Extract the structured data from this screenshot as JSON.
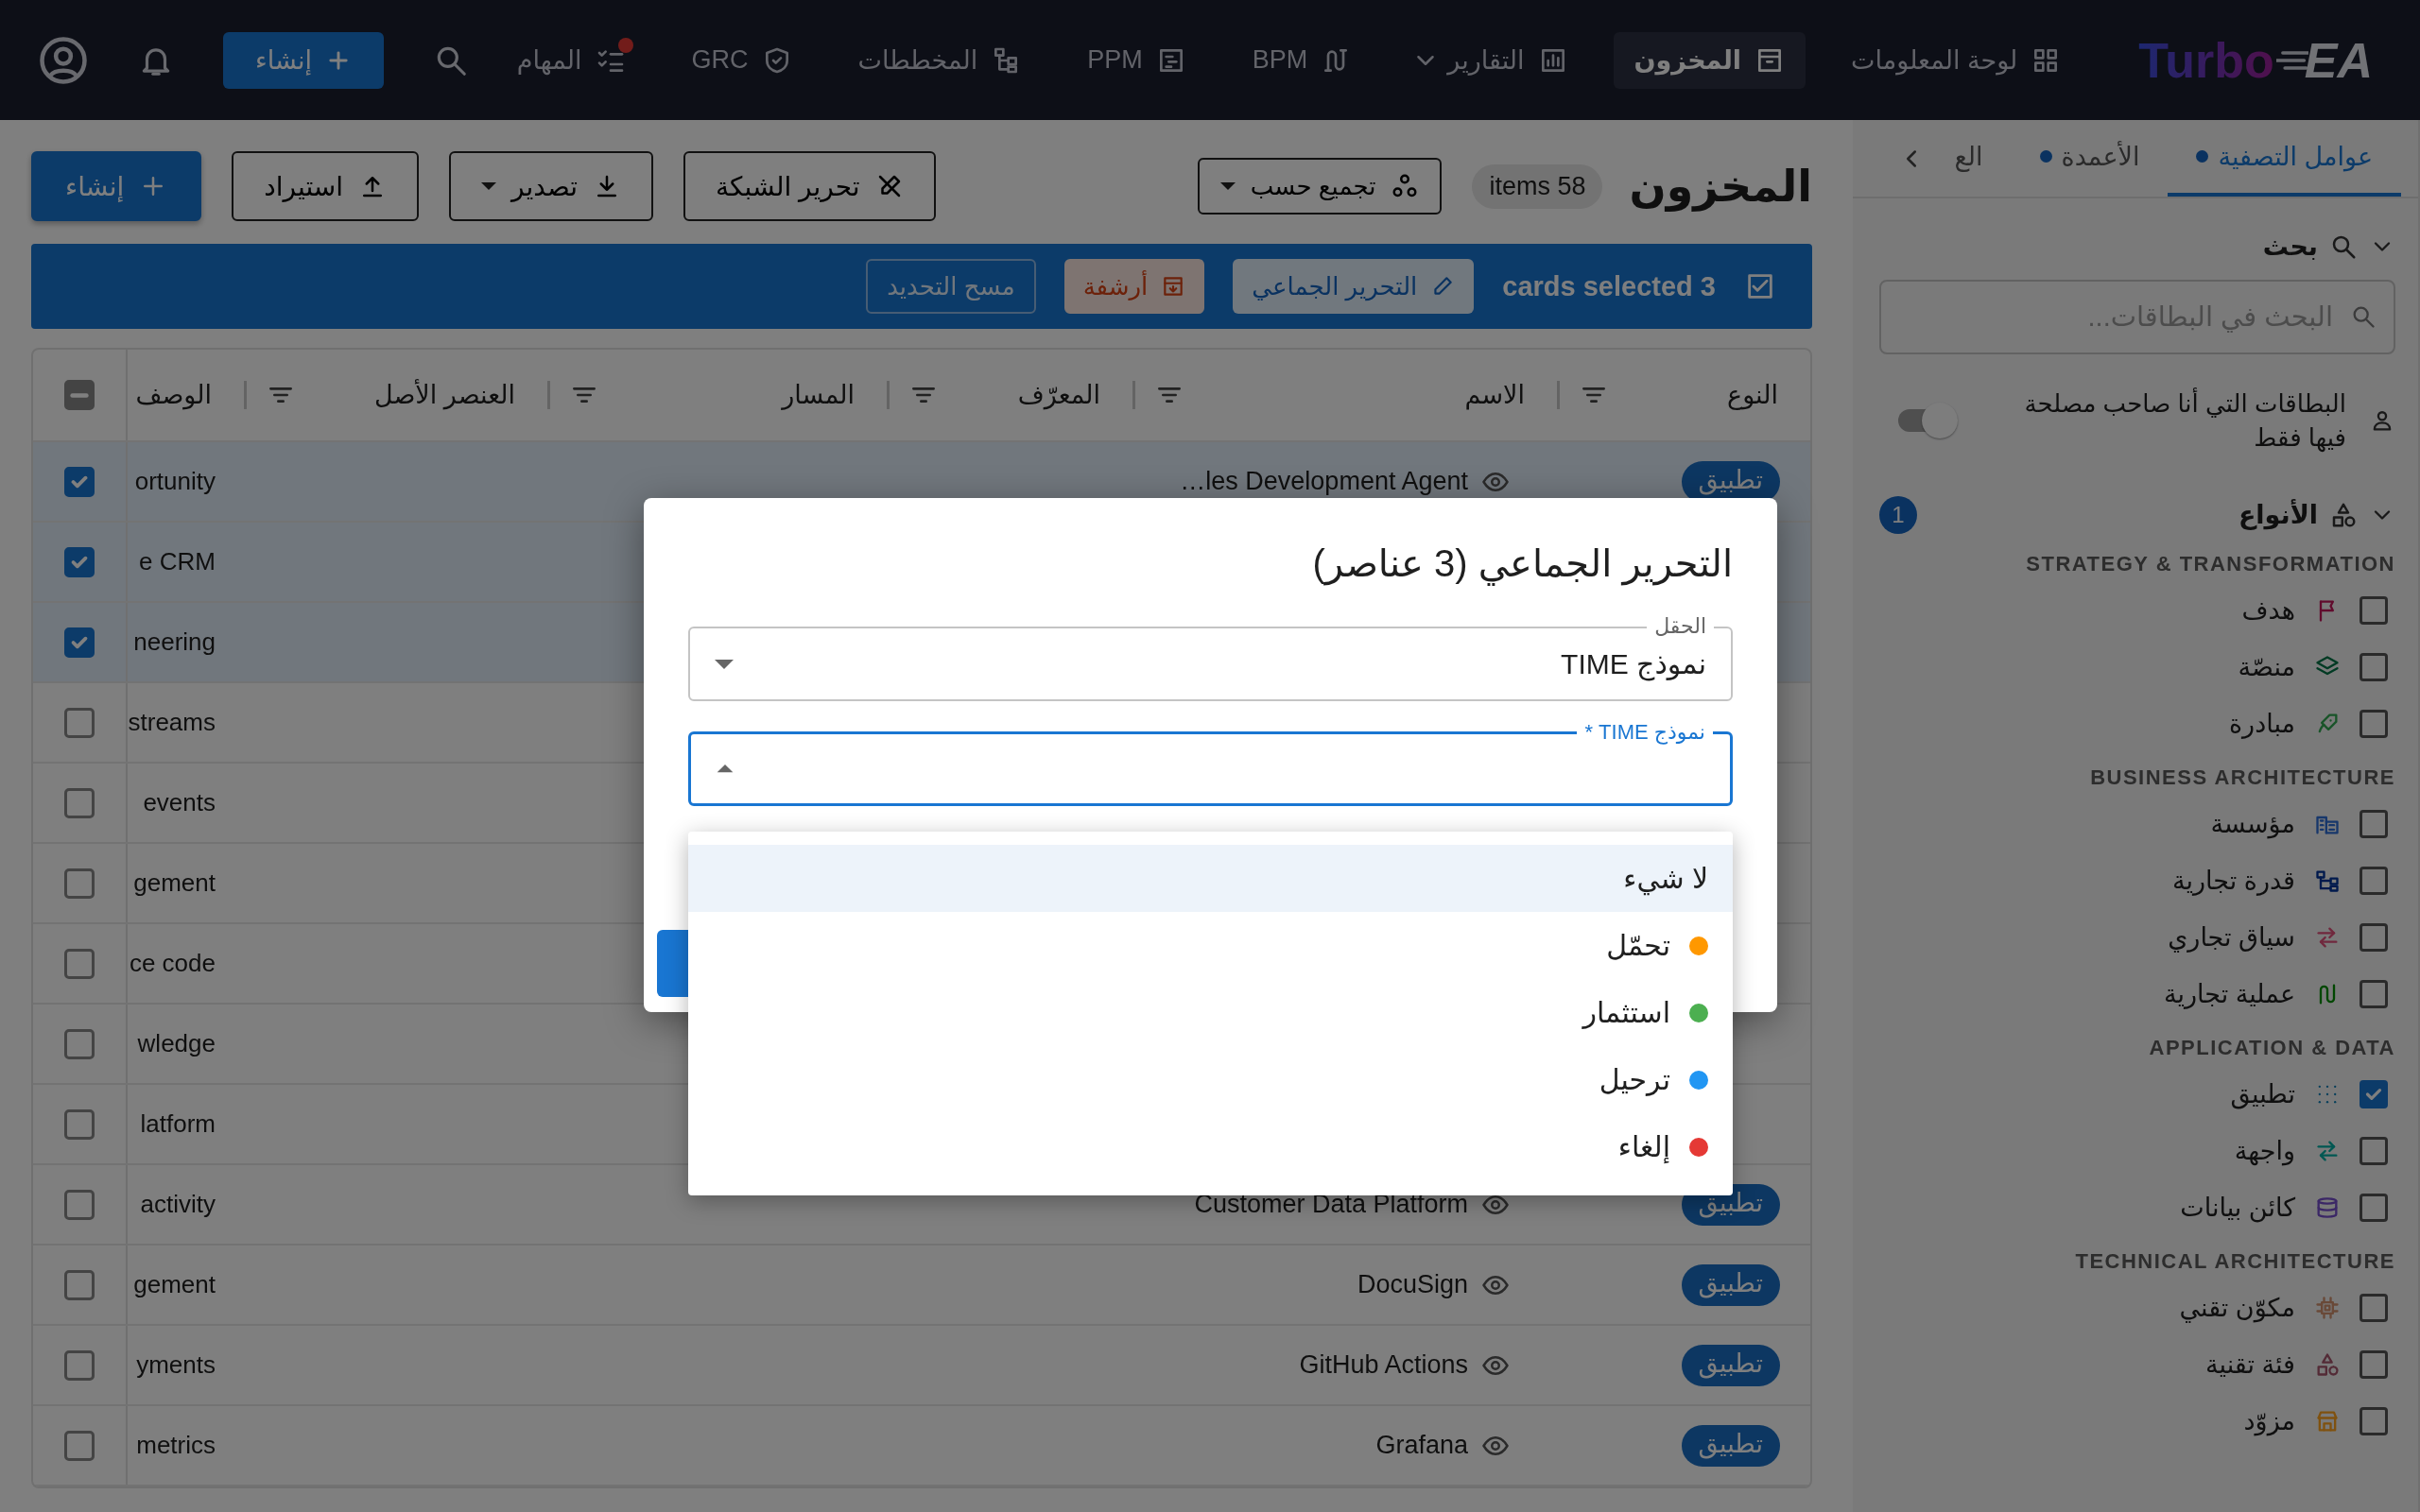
{
  "topbar": {
    "brand": "Turbo",
    "brand_suffix": "EA",
    "nav": [
      {
        "label": "لوحة المعلومات",
        "selected": false,
        "dropdown": false,
        "dot": false
      },
      {
        "label": "المخزون",
        "selected": true,
        "dropdown": false,
        "dot": false
      },
      {
        "label": "التقارير",
        "selected": false,
        "dropdown": true,
        "dot": false
      },
      {
        "label": "BPM",
        "selected": false,
        "dropdown": false,
        "dot": false
      },
      {
        "label": "PPM",
        "selected": false,
        "dropdown": false,
        "dot": false
      },
      {
        "label": "المخططات",
        "selected": false,
        "dropdown": false,
        "dot": false
      },
      {
        "label": "GRC",
        "selected": false,
        "dropdown": false,
        "dot": false
      },
      {
        "label": "المهام",
        "selected": false,
        "dropdown": false,
        "dot": true
      }
    ],
    "create_button": "إنشاء"
  },
  "page": {
    "title": "المخزون",
    "count": "items 58",
    "group_by": "تجميع حسب",
    "buttons": [
      {
        "kind": "grid_edit",
        "label": "تحرير الشبكة"
      },
      {
        "kind": "export",
        "label": "تصدير"
      },
      {
        "kind": "import",
        "label": "استيراد"
      },
      {
        "kind": "create",
        "label": "إنشاء"
      }
    ]
  },
  "selection_bar": {
    "checked": true,
    "text": "cards selected 3",
    "bulk_edit": "التحرير الجماعي",
    "archive": "أرشفة",
    "clear": "مسح التحديد"
  },
  "table": {
    "columns": [
      "النوع",
      "الاسم",
      "المعرّف",
      "المسار",
      "العنصر الأصل",
      "الوصف"
    ],
    "select_all": {
      "indeterminate": true
    },
    "rows": [
      {
        "selected": true,
        "type": "تطبيق",
        "name": "…les Development Agent",
        "description": "ortunity"
      },
      {
        "selected": true,
        "description": "e CRM"
      },
      {
        "selected": true,
        "description": "neering"
      },
      {
        "selected": false,
        "description": "streams"
      },
      {
        "selected": false,
        "description": "events"
      },
      {
        "selected": false,
        "description": "gement"
      },
      {
        "selected": false,
        "description": "ce code"
      },
      {
        "selected": false,
        "description": "wledge"
      },
      {
        "selected": false,
        "description": "latform"
      },
      {
        "selected": false,
        "type": "تطبيق",
        "name": "Customer Data Platform",
        "description": "activity"
      },
      {
        "selected": false,
        "type": "تطبيق",
        "name": "DocuSign",
        "description": "gement"
      },
      {
        "selected": false,
        "type": "تطبيق",
        "name": "GitHub Actions",
        "description": "yments"
      },
      {
        "selected": false,
        "type": "تطبيق",
        "name": "Grafana",
        "description": "metrics"
      }
    ]
  },
  "sidebar": {
    "tabs": [
      {
        "label": "عوامل التصفية",
        "selected": true,
        "dot": true
      },
      {
        "label": "الأعمدة",
        "selected": false,
        "dot": true
      },
      {
        "label": "الع",
        "selected": false,
        "dot": false
      }
    ],
    "search": {
      "title": "بحث",
      "expanded": true,
      "placeholder": "البحث في البطاقات..."
    },
    "stakeholder_toggle": {
      "label": "البطاقات التي أنا صاحب مصلحة فيها فقط",
      "on": false
    },
    "types": {
      "title": "الأنواع",
      "expanded": true,
      "badge": "1",
      "groups": [
        {
          "title": "STRATEGY & TRANSFORMATION",
          "items": [
            {
              "label": "هدف",
              "checked": false
            },
            {
              "label": "منصّة",
              "checked": false
            },
            {
              "label": "مبادرة",
              "checked": false
            }
          ]
        },
        {
          "title": "BUSINESS ARCHITECTURE",
          "items": [
            {
              "label": "مؤسسة",
              "checked": false
            },
            {
              "label": "قدرة تجارية",
              "checked": false
            },
            {
              "label": "سياق تجاري",
              "checked": false
            },
            {
              "label": "عملية تجارية",
              "checked": false
            }
          ]
        },
        {
          "title": "APPLICATION & DATA",
          "items": [
            {
              "label": "تطبيق",
              "checked": true
            },
            {
              "label": "واجهة",
              "checked": false
            },
            {
              "label": "كائن بيانات",
              "checked": false
            }
          ]
        },
        {
          "title": "TECHNICAL ARCHITECTURE",
          "items": [
            {
              "label": "مكوّن تقني",
              "checked": false
            },
            {
              "label": "فئة تقنية",
              "checked": false
            },
            {
              "label": "مزوّد",
              "checked": false
            }
          ]
        }
      ]
    }
  },
  "dialog": {
    "title": "التحرير الجماعي (3 عناصر)",
    "field": {
      "label": "الحقل",
      "value": "نموذج TIME"
    },
    "value_field": {
      "label": "نموذج TIME *",
      "open": true
    },
    "options": [
      {
        "label": "لا شيء",
        "selected": true
      },
      {
        "label": "تحمّل",
        "color": "#ff9800",
        "selected": false
      },
      {
        "label": "استثمار",
        "color": "#4caf50",
        "selected": false
      },
      {
        "label": "ترحيل",
        "color": "#2196f3",
        "selected": false
      },
      {
        "label": "إلغاء",
        "color": "#e53935",
        "selected": false
      }
    ]
  }
}
